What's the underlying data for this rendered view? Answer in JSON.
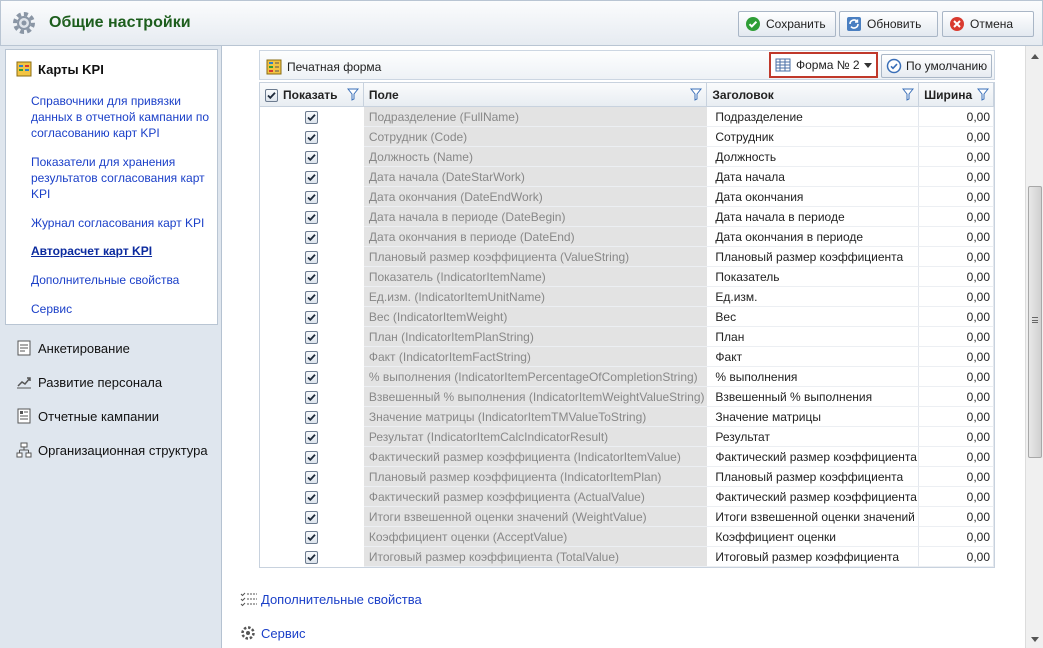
{
  "header": {
    "title": "Общие настройки",
    "save_label": "Сохранить",
    "refresh_label": "Обновить",
    "cancel_label": "Отмена"
  },
  "sidebar": {
    "kpi_title": "Карты KPI",
    "kpi_links": [
      "Справочники для привязки данных в отчетной кампании по согласованию карт KPI",
      "Показатели для хранения результатов согласования карт KPI",
      "Журнал согласования карт KPI",
      "Авторасчет карт KPI",
      "Дополнительные свойства",
      "Сервис"
    ],
    "sections": [
      "Анкетирование",
      "Развитие персонала",
      "Отчетные кампании",
      "Организационная структура"
    ]
  },
  "toolbar": {
    "print_form_label": "Печатная форма",
    "form_selected": "Форма № 2",
    "default_label": "По умолчанию"
  },
  "grid": {
    "columns": [
      "Показать",
      "Поле",
      "Заголовок",
      "Ширина"
    ],
    "rows": [
      {
        "field": "Подразделение (FullName)",
        "caption": "Подразделение",
        "width": "0,00"
      },
      {
        "field": "Сотрудник (Code)",
        "caption": "Сотрудник",
        "width": "0,00"
      },
      {
        "field": "Должность (Name)",
        "caption": "Должность",
        "width": "0,00"
      },
      {
        "field": "Дата начала (DateStarWork)",
        "caption": "Дата начала",
        "width": "0,00"
      },
      {
        "field": "Дата окончания (DateEndWork)",
        "caption": "Дата окончания",
        "width": "0,00"
      },
      {
        "field": "Дата начала в периоде (DateBegin)",
        "caption": "Дата начала в периоде",
        "width": "0,00"
      },
      {
        "field": "Дата окончания в периоде (DateEnd)",
        "caption": "Дата окончания в периоде",
        "width": "0,00"
      },
      {
        "field": "Плановый размер коэффициента (ValueString)",
        "caption": "Плановый размер коэффициента",
        "width": "0,00"
      },
      {
        "field": "Показатель (IndicatorItemName)",
        "caption": "Показатель",
        "width": "0,00"
      },
      {
        "field": "Ед.изм. (IndicatorItemUnitName)",
        "caption": "Ед.изм.",
        "width": "0,00"
      },
      {
        "field": "Вес (IndicatorItemWeight)",
        "caption": "Вес",
        "width": "0,00"
      },
      {
        "field": "План (IndicatorItemPlanString)",
        "caption": "План",
        "width": "0,00"
      },
      {
        "field": "Факт (IndicatorItemFactString)",
        "caption": "Факт",
        "width": "0,00"
      },
      {
        "field": "% выполнения (IndicatorItemPercentageOfCompletionString)",
        "caption": "% выполнения",
        "width": "0,00"
      },
      {
        "field": "Взвешенный % выполнения (IndicatorItemWeightValueString)",
        "caption": "Взвешенный % выполнения",
        "width": "0,00"
      },
      {
        "field": "Значение матрицы (IndicatorItemTMValueToString)",
        "caption": "Значение матрицы",
        "width": "0,00"
      },
      {
        "field": "Результат (IndicatorItemCalcIndicatorResult)",
        "caption": "Результат",
        "width": "0,00"
      },
      {
        "field": "Фактический размер коэффициента (IndicatorItemValue)",
        "caption": "Фактический размер коэффициента",
        "width": "0,00"
      },
      {
        "field": "Плановый размер коэффициента (IndicatorItemPlan)",
        "caption": "Плановый размер коэффициента",
        "width": "0,00"
      },
      {
        "field": "Фактический размер коэффициента (ActualValue)",
        "caption": "Фактический размер коэффициента",
        "width": "0,00"
      },
      {
        "field": "Итоги взвешенной оценки значений (WeightValue)",
        "caption": "Итоги взвешенной оценки значений",
        "width": "0,00"
      },
      {
        "field": "Коэффициент оценки (AcceptValue)",
        "caption": "Коэффициент оценки",
        "width": "0,00"
      },
      {
        "field": "Итоговый размер коэффициента (TotalValue)",
        "caption": "Итоговый размер коэффициента",
        "width": "0,00"
      }
    ]
  },
  "bottom_links": [
    "Дополнительные свойства",
    "Сервис"
  ],
  "colors": {
    "title_green": "#1d5e1d",
    "link_blue": "#1a3fc8",
    "highlight_red": "#c0392b"
  }
}
